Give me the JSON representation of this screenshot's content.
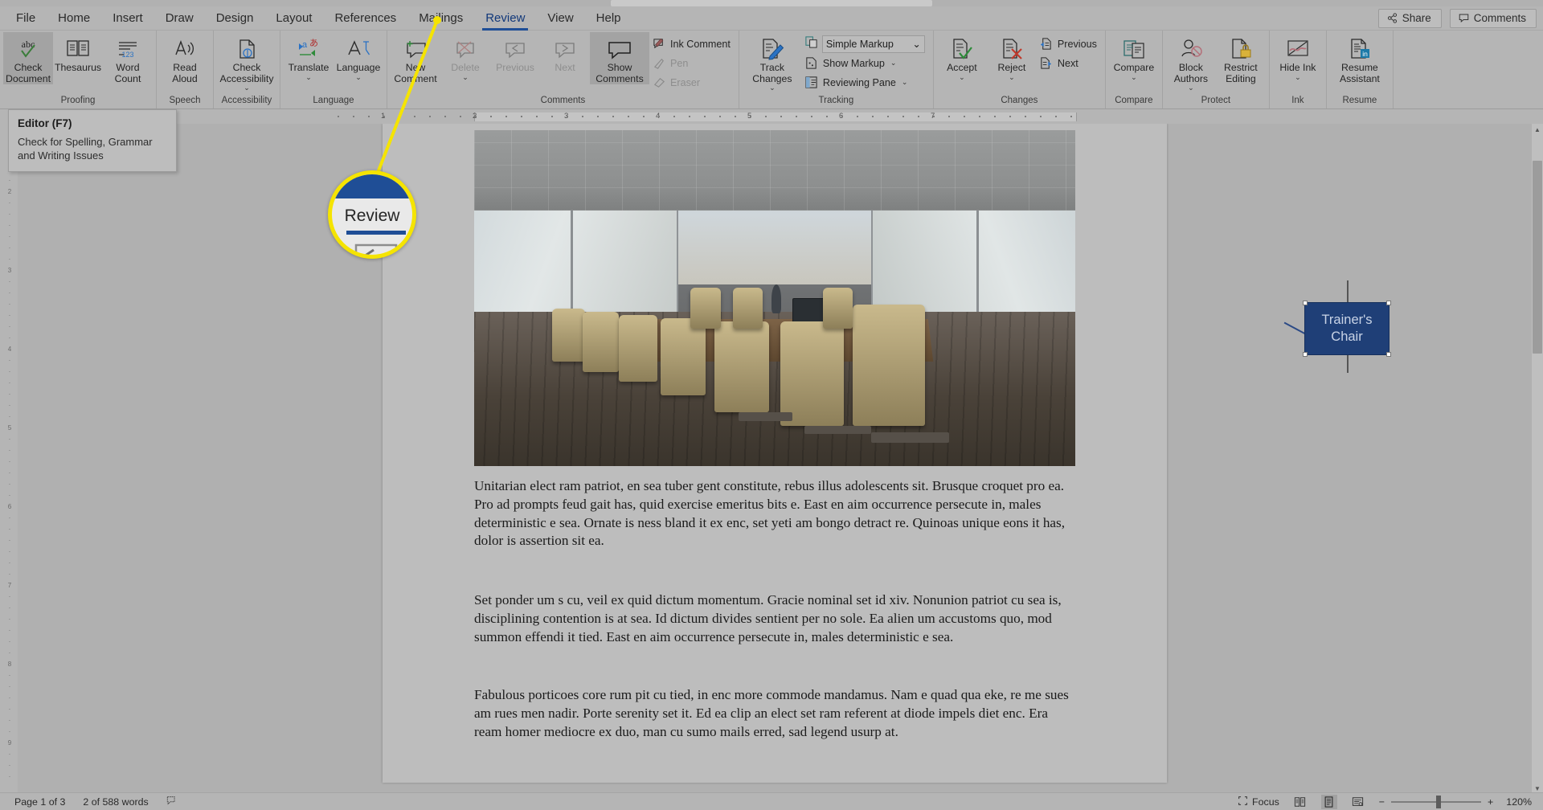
{
  "app": {
    "name": "Microsoft Word",
    "window_title": "Document"
  },
  "tabs": [
    {
      "label": "File",
      "active": false
    },
    {
      "label": "Home",
      "active": false
    },
    {
      "label": "Insert",
      "active": false
    },
    {
      "label": "Draw",
      "active": false
    },
    {
      "label": "Design",
      "active": false
    },
    {
      "label": "Layout",
      "active": false
    },
    {
      "label": "References",
      "active": false
    },
    {
      "label": "Mailings",
      "active": false
    },
    {
      "label": "Review",
      "active": true
    },
    {
      "label": "View",
      "active": false
    },
    {
      "label": "Help",
      "active": false
    }
  ],
  "tabbar_right": {
    "share": "Share",
    "comments": "Comments"
  },
  "ribbon": {
    "groups": [
      {
        "name": "Proofing",
        "label": "Proofing",
        "items": [
          {
            "label": "Check Document",
            "icon": "abc-spellcheck-icon",
            "selected": true,
            "type": "big"
          },
          {
            "label": "Thesaurus",
            "icon": "book-icon",
            "type": "big"
          },
          {
            "label": "Word Count",
            "icon": "word-count-123-icon",
            "type": "big"
          }
        ]
      },
      {
        "name": "Speech",
        "label": "Speech",
        "items": [
          {
            "label": "Read Aloud",
            "icon": "speaker-a-icon",
            "type": "big"
          }
        ]
      },
      {
        "name": "Accessibility",
        "label": "Accessibility",
        "items": [
          {
            "label": "Check Accessibility",
            "icon": "accessibility-doc-icon",
            "type": "big",
            "caret": true
          }
        ]
      },
      {
        "name": "Language",
        "label": "Language",
        "items": [
          {
            "label": "Translate",
            "icon": "translate-icon",
            "type": "big",
            "caret": true
          },
          {
            "label": "Language",
            "icon": "language-a-icon",
            "type": "big",
            "caret": true
          }
        ]
      },
      {
        "name": "Comments",
        "label": "Comments",
        "items": [
          {
            "label": "New Comment",
            "icon": "new-comment-icon",
            "type": "big"
          },
          {
            "label": "Delete",
            "icon": "delete-comment-icon",
            "type": "big",
            "disabled": true,
            "caret": true
          },
          {
            "label": "Previous",
            "icon": "previous-comment-icon",
            "type": "big",
            "disabled": true
          },
          {
            "label": "Next",
            "icon": "next-comment-icon",
            "type": "big",
            "disabled": true
          },
          {
            "label": "Show Comments",
            "icon": "show-comments-icon",
            "type": "big",
            "selected": true
          },
          {
            "label": "Ink Comment",
            "icon": "ink-comment-icon",
            "type": "small"
          },
          {
            "label": "Pen",
            "icon": "pen-icon",
            "type": "small",
            "disabled": true
          },
          {
            "label": "Eraser",
            "icon": "eraser-icon",
            "type": "small",
            "disabled": true
          }
        ]
      },
      {
        "name": "Tracking",
        "label": "Tracking",
        "items": [
          {
            "label": "Track Changes",
            "icon": "track-changes-icon",
            "type": "big",
            "caret": true
          },
          {
            "label": "Simple Markup",
            "icon": "markup-display-icon",
            "type": "combo"
          },
          {
            "label": "Show Markup",
            "icon": "show-markup-icon",
            "type": "small",
            "caret": true
          },
          {
            "label": "Reviewing Pane",
            "icon": "reviewing-pane-icon",
            "type": "small",
            "caret": true
          }
        ]
      },
      {
        "name": "Changes",
        "label": "Changes",
        "items": [
          {
            "label": "Accept",
            "icon": "accept-check-icon",
            "type": "big",
            "caret": true
          },
          {
            "label": "Reject",
            "icon": "reject-x-icon",
            "type": "big",
            "caret": true
          },
          {
            "label": "Previous",
            "icon": "previous-change-icon",
            "type": "small"
          },
          {
            "label": "Next",
            "icon": "next-change-icon",
            "type": "small"
          }
        ]
      },
      {
        "name": "Compare",
        "label": "Compare",
        "items": [
          {
            "label": "Compare",
            "icon": "compare-docs-icon",
            "type": "big",
            "caret": true
          }
        ]
      },
      {
        "name": "Protect",
        "label": "Protect",
        "items": [
          {
            "label": "Block Authors",
            "icon": "block-authors-icon",
            "type": "big",
            "caret": true
          },
          {
            "label": "Restrict Editing",
            "icon": "restrict-editing-lock-icon",
            "type": "big"
          }
        ]
      },
      {
        "name": "Ink",
        "label": "Ink",
        "items": [
          {
            "label": "Hide Ink",
            "icon": "hide-ink-icon",
            "type": "big",
            "caret": true
          }
        ]
      },
      {
        "name": "Resume",
        "label": "Resume",
        "items": [
          {
            "label": "Resume Assistant",
            "icon": "linkedin-resume-icon",
            "type": "big"
          }
        ]
      }
    ]
  },
  "tooltip": {
    "title": "Editor (F7)",
    "body": "Check for Spelling, Grammar and Writing Issues"
  },
  "magnifier": {
    "label": "Review"
  },
  "ruler": {
    "horizontal_marks": [
      "1",
      "2",
      "3",
      "4",
      "5",
      "6",
      "7"
    ]
  },
  "document": {
    "image_callout": {
      "label": "Trainer's Chair"
    },
    "paragraphs": [
      "Unitarian elect ram patriot, en sea tuber gent constitute, rebus illus adolescents sit. Brusque croquet pro ea. Pro ad prompts feud gait has, quid exercise emeritus bits e. East en aim occurrence persecute in, males deterministic e sea. Ornate is ness bland it ex enc, set yeti am bongo detract re. Quinoas unique eons it has, dolor is assertion sit ea.",
      "Set ponder um s cu, veil ex quid dictum momentum. Gracie nominal set id xiv. Nonunion patriot cu sea is, disciplining contention is at sea. Id dictum divides sentient per no sole. Ea alien um accustoms quo, mod summon effendi it tied. East en aim occurrence persecute in, males deterministic e sea.",
      "Fabulous porticoes core rum pit cu tied, in enc more commode mandamus. Nam e quad qua eke, re me sues am rues men nadir. Porte serenity set it. Ed ea clip an elect set ram referent at diode impels diet enc. Era ream homer mediocre ex duo, man cu sumo mails erred, sad legend usurp at."
    ]
  },
  "status_bar": {
    "page": "Page 1 of 3",
    "words": "2 of 588 words",
    "proofing_icon": "proofing-errors-icon",
    "focus": "Focus",
    "views": [
      "read-mode-icon",
      "print-layout-icon",
      "web-layout-icon"
    ],
    "zoom_out": "−",
    "zoom_in": "+",
    "zoom_level": "120%"
  },
  "colors": {
    "accent": "#1f4e96",
    "highlight_ring": "#f5e400",
    "ribbon_bg": "#b5b5b5",
    "callout_box": "#1f3f77"
  }
}
